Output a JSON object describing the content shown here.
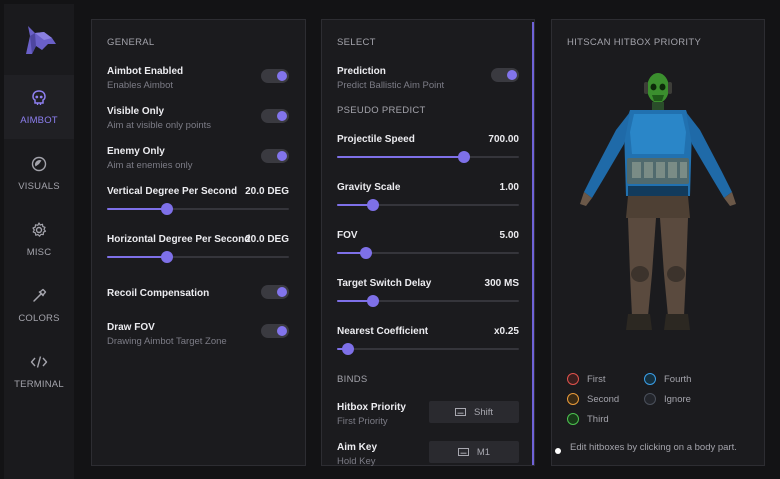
{
  "colors": {
    "accent": "#8274ec",
    "first": "#e0524c",
    "second": "#e89a3a",
    "third": "#4cc24f",
    "fourth": "#3a9fe8",
    "ignore": "#4a4f5a"
  },
  "sidebar": {
    "items": [
      {
        "label": "AIMBOT",
        "icon": "skull-icon",
        "active": true
      },
      {
        "label": "VISUALS",
        "icon": "eye-icon",
        "active": false
      },
      {
        "label": "MISC",
        "icon": "gear-icon",
        "active": false
      },
      {
        "label": "COLORS",
        "icon": "dropper-icon",
        "active": false
      },
      {
        "label": "TERMINAL",
        "icon": "code-icon",
        "active": false
      }
    ]
  },
  "general": {
    "title": "GENERAL",
    "aimbot_enabled": {
      "title": "Aimbot Enabled",
      "sub": "Enables Aimbot",
      "on": true
    },
    "visible_only": {
      "title": "Visible Only",
      "sub": "Aim at visible only points",
      "on": true
    },
    "enemy_only": {
      "title": "Enemy Only",
      "sub": "Aim at enemies only",
      "on": true
    },
    "vertical_dps": {
      "title": "Vertical Degree Per Second",
      "value": "20.0 DEG",
      "fraction": 0.33
    },
    "horizontal_dps": {
      "title": "Horizontal Degree Per Second",
      "value": "20.0 DEG",
      "fraction": 0.33
    },
    "recoil": {
      "title": "Recoil Compensation",
      "on": true
    },
    "draw_fov": {
      "title": "Draw FOV",
      "sub": "Drawing Aimbot Target Zone",
      "on": true
    }
  },
  "select": {
    "title": "SELECT",
    "prediction": {
      "title": "Prediction",
      "sub": "Predict Ballistic Aim Point",
      "on": true
    },
    "pseudo_title": "PSEUDO PREDICT",
    "projectile_speed": {
      "title": "Projectile Speed",
      "value": "700.00",
      "fraction": 0.7
    },
    "gravity_scale": {
      "title": "Gravity Scale",
      "value": "1.00",
      "fraction": 0.2
    },
    "fov": {
      "title": "FOV",
      "value": "5.00",
      "fraction": 0.16
    },
    "target_switch": {
      "title": "Target Switch Delay",
      "value": "300 MS",
      "fraction": 0.2
    },
    "nearest_coef": {
      "title": "Nearest Coefficient",
      "value": "x0.25",
      "fraction": 0.06
    },
    "binds_title": "BINDS",
    "hitbox_priority": {
      "title": "Hitbox Priority",
      "sub": "First Priority",
      "key": "Shift"
    },
    "aim_key": {
      "title": "Aim Key",
      "sub": "Hold Key",
      "key": "M1"
    }
  },
  "hitscan": {
    "title": "HITSCAN HITBOX PRIORITY",
    "legend": {
      "first": "First",
      "second": "Second",
      "third": "Third",
      "fourth": "Fourth",
      "ignore": "Ignore"
    },
    "hint": "Edit hitboxes by clicking on a body part."
  }
}
